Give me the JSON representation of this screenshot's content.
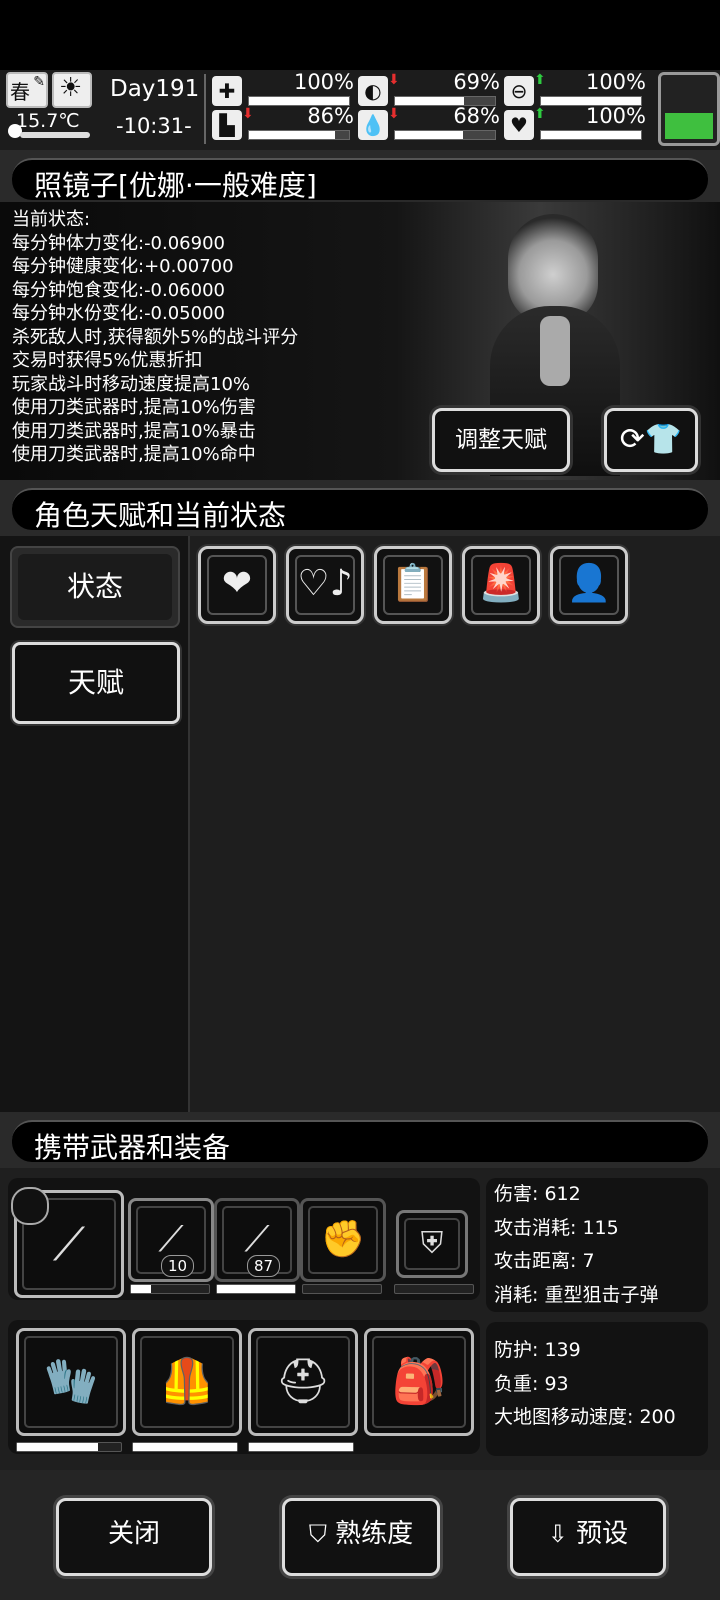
{
  "status_bar": {
    "season": "春",
    "temperature": "15.7℃",
    "day": "Day191",
    "time": "-10:31-",
    "stats": [
      {
        "icon": "medkit-icon",
        "value": "100%",
        "trend": "none",
        "level": 1.0
      },
      {
        "icon": "stomach-icon",
        "value": "69%",
        "trend": "down",
        "level": 0.69
      },
      {
        "icon": "capsule-icon",
        "value": "100%",
        "trend": "up",
        "level": 1.0
      },
      {
        "icon": "boot-icon",
        "value": "86%",
        "trend": "down",
        "level": 0.86
      },
      {
        "icon": "water-drop-icon",
        "value": "68%",
        "trend": "down",
        "level": 0.68
      },
      {
        "icon": "heart-icon",
        "value": "100%",
        "trend": "up",
        "level": 1.0
      }
    ],
    "battery_level": 0.38
  },
  "mirror": {
    "title": "照镜子[优娜·一般难度]",
    "lines": [
      "当前状态:",
      "每分钟体力变化:-0.06900",
      "每分钟健康变化:+0.00700",
      "每分钟饱食变化:-0.06000",
      "每分钟水份变化:-0.05000",
      "杀死敌人时,获得额外5%的战斗评分",
      "交易时获得5%优惠折扣",
      "玩家战斗时移动速度提高10%",
      "使用刀类武器时,提高10%伤害",
      "使用刀类武器时,提高10%暴击",
      "使用刀类武器时,提高10%命中"
    ],
    "adjust_talent_label": "调整天赋"
  },
  "talent_section": {
    "title": "角色天赋和当前状态",
    "tabs": [
      "状态",
      "天赋"
    ],
    "status_icons": [
      "heart-icon",
      "music-heart-icon",
      "clipboard-bandage-icon",
      "alarm-person-icon",
      "person-heartbeat-icon"
    ]
  },
  "equipment_section": {
    "title": "携带武器和装备",
    "weapons": [
      {
        "icon": "sniper-rifle-icon",
        "badge": "",
        "durability": null
      },
      {
        "icon": "rifle-bayonet-icon",
        "badge": "10",
        "durability": 0.25
      },
      {
        "icon": "minigun-icon",
        "badge": "87",
        "durability": 1.0
      },
      {
        "icon": "fist-icon",
        "badge": "",
        "durability": 0.0
      },
      {
        "icon": "riot-shield-icon",
        "badge": "",
        "durability": 0.0
      }
    ],
    "weapon_stats": [
      "伤害: 612",
      "攻击消耗: 115",
      "攻击距离: 7",
      "消耗: 重型狙击子弹"
    ],
    "armor": [
      {
        "icon": "gloves-icon",
        "durability": 0.78
      },
      {
        "icon": "body-armor-icon",
        "durability": 1.0
      },
      {
        "icon": "helmet-icon",
        "durability": 1.0
      },
      {
        "icon": "backpack-icon",
        "durability": null
      }
    ],
    "armor_stats": [
      "防护: 139",
      "负重: 93",
      "大地图移动速度: 200"
    ]
  },
  "bottom_buttons": {
    "close": "关闭",
    "proficiency": "熟练度",
    "preset": "预设"
  }
}
